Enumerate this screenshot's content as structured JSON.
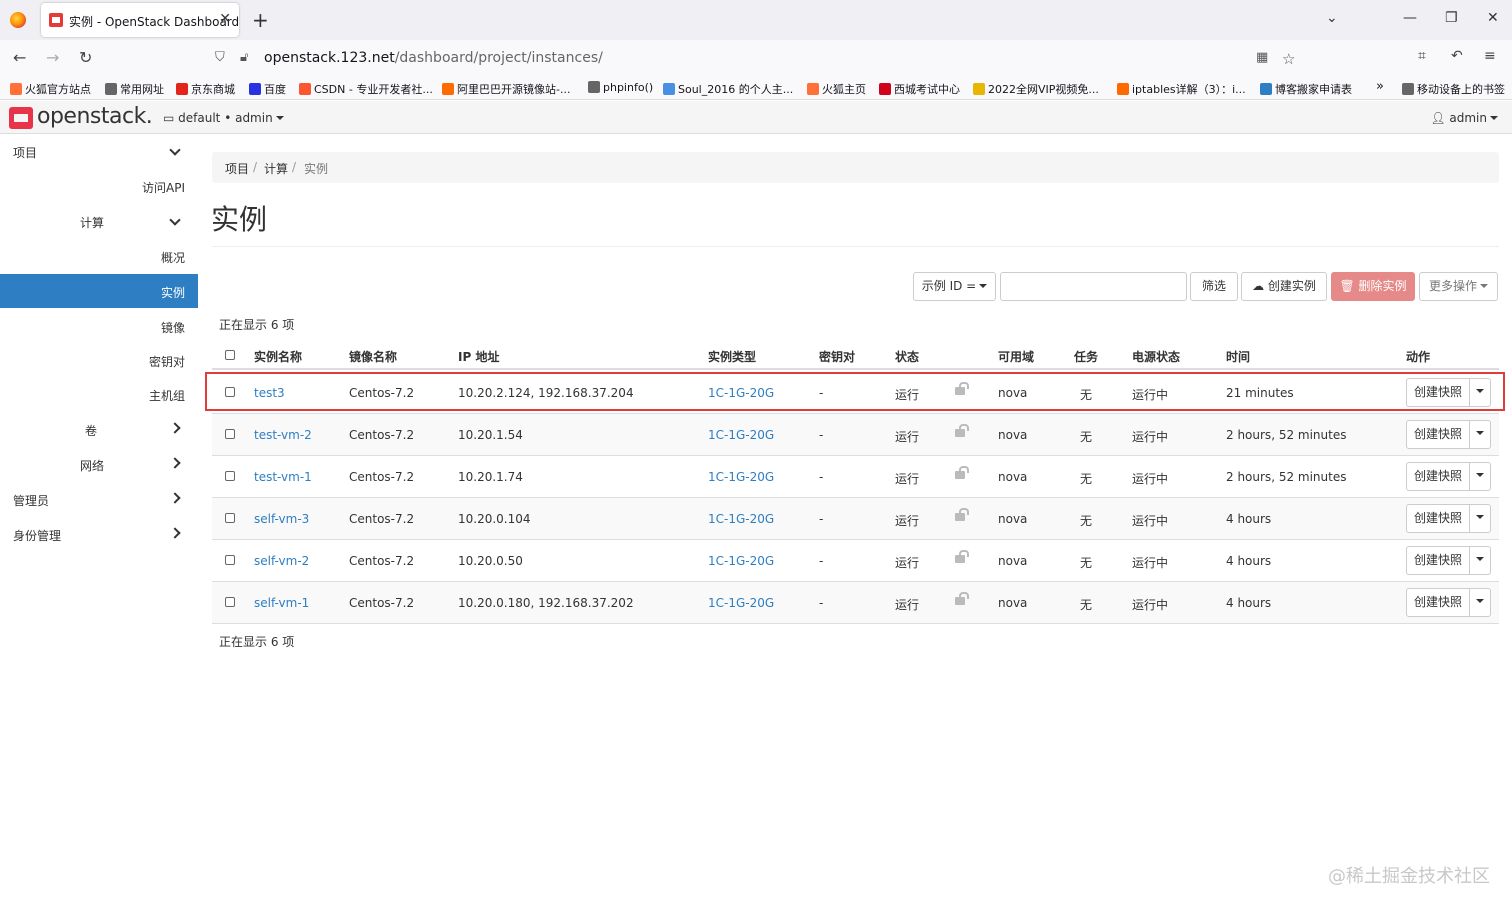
{
  "browser": {
    "tab_title": "实例 - OpenStack Dashboard",
    "url_host": "openstack.123.net",
    "url_path": "/dashboard/project/instances/",
    "url_scheme": ""
  },
  "bookmarks": [
    {
      "label": "火狐官方站点",
      "color": "#ff7139"
    },
    {
      "label": "常用网址",
      "color": "#666666"
    },
    {
      "label": "京东商城",
      "color": "#e1251b"
    },
    {
      "label": "百度",
      "color": "#2932e1"
    },
    {
      "label": "CSDN - 专业开发者社...",
      "color": "#fc5531"
    },
    {
      "label": "阿里巴巴开源镜像站-...",
      "color": "#ff6a00"
    },
    {
      "label": "phpinfo()",
      "color": "#666666"
    },
    {
      "label": "Soul_2016 的个人主...",
      "color": "#4a90e2"
    },
    {
      "label": "火狐主页",
      "color": "#ff7139"
    },
    {
      "label": "西城考试中心",
      "color": "#d0021b"
    },
    {
      "label": "2022全网VIP视频免...",
      "color": "#e8b500"
    },
    {
      "label": "iptables详解（3）：i...",
      "color": "#ff6a00"
    },
    {
      "label": "博客搬家申请表",
      "color": "#2d7ec2"
    },
    {
      "label": "移动设备上的书签",
      "color": "#666666"
    }
  ],
  "header": {
    "logo": "openstack.",
    "project": "default • admin",
    "user": "admin"
  },
  "sidebar": {
    "items": [
      {
        "label": "项目",
        "chevron": "down"
      },
      {
        "label": "访问API"
      },
      {
        "label": "计算",
        "chevron": "down"
      },
      {
        "label": "概况"
      },
      {
        "label": "实例",
        "active": true
      },
      {
        "label": "镜像"
      },
      {
        "label": "密钥对"
      },
      {
        "label": "主机组"
      },
      {
        "label": "卷",
        "chevron": "right"
      },
      {
        "label": "网络",
        "chevron": "right"
      },
      {
        "label": "管理员",
        "chevron": "right"
      },
      {
        "label": "身份管理",
        "chevron": "right"
      }
    ]
  },
  "breadcrumb": [
    "项目",
    "计算",
    "实例"
  ],
  "page_title": "实例",
  "toolbar": {
    "filter_select": "示例 ID =",
    "filter_value": "",
    "filter_button": "筛选",
    "create_button": "创建实例",
    "delete_button": "删除实例",
    "more_button": "更多操作"
  },
  "count_text": "正在显示 6 项",
  "table": {
    "headers": [
      "实例名称",
      "镜像名称",
      "IP 地址",
      "实例类型",
      "密钥对",
      "状态",
      "可用域",
      "任务",
      "电源状态",
      "时间",
      "动作"
    ],
    "rows": [
      {
        "name": "test3",
        "image": "Centos-7.2",
        "ip": "10.20.2.124, 192.168.37.204",
        "flavor": "1C-1G-20G",
        "key": "-",
        "status": "运行",
        "az": "nova",
        "task": "无",
        "power": "运行中",
        "time": "21 minutes",
        "action": "创建快照"
      },
      {
        "name": "test-vm-2",
        "image": "Centos-7.2",
        "ip": "10.20.1.54",
        "flavor": "1C-1G-20G",
        "key": "-",
        "status": "运行",
        "az": "nova",
        "task": "无",
        "power": "运行中",
        "time": "2 hours, 52 minutes",
        "action": "创建快照"
      },
      {
        "name": "test-vm-1",
        "image": "Centos-7.2",
        "ip": "10.20.1.74",
        "flavor": "1C-1G-20G",
        "key": "-",
        "status": "运行",
        "az": "nova",
        "task": "无",
        "power": "运行中",
        "time": "2 hours, 52 minutes",
        "action": "创建快照"
      },
      {
        "name": "self-vm-3",
        "image": "Centos-7.2",
        "ip": "10.20.0.104",
        "flavor": "1C-1G-20G",
        "key": "-",
        "status": "运行",
        "az": "nova",
        "task": "无",
        "power": "运行中",
        "time": "4 hours",
        "action": "创建快照"
      },
      {
        "name": "self-vm-2",
        "image": "Centos-7.2",
        "ip": "10.20.0.50",
        "flavor": "1C-1G-20G",
        "key": "-",
        "status": "运行",
        "az": "nova",
        "task": "无",
        "power": "运行中",
        "time": "4 hours",
        "action": "创建快照"
      },
      {
        "name": "self-vm-1",
        "image": "Centos-7.2",
        "ip": "10.20.0.180, 192.168.37.202",
        "flavor": "1C-1G-20G",
        "key": "-",
        "status": "运行",
        "az": "nova",
        "task": "无",
        "power": "运行中",
        "time": "4 hours",
        "action": "创建快照"
      }
    ]
  },
  "watermark": "@稀土掘金技术社区",
  "colors": {
    "accent": "#2d7ec2",
    "danger": "#e58a89",
    "highlight": "#e03c3c",
    "brand": "#e8344a"
  }
}
